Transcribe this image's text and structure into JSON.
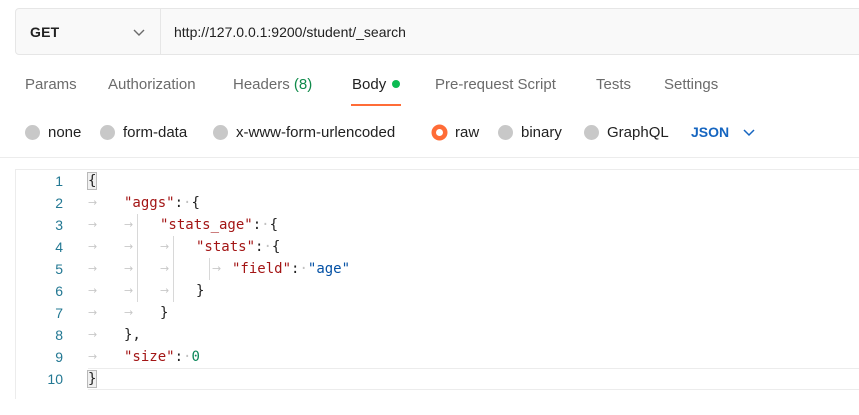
{
  "request": {
    "method": "GET",
    "url": "http://127.0.0.1:9200/student/_search"
  },
  "tabs": [
    {
      "label": "Params"
    },
    {
      "label": "Authorization"
    },
    {
      "label": "Headers",
      "count": "(8)"
    },
    {
      "label": "Body",
      "active": true,
      "indicator": "green-dot"
    },
    {
      "label": "Pre-request Script"
    },
    {
      "label": "Tests"
    },
    {
      "label": "Settings"
    }
  ],
  "body_types": {
    "options": [
      "none",
      "form-data",
      "x-www-form-urlencoded",
      "raw",
      "binary",
      "GraphQL"
    ],
    "selected": "raw",
    "format": "JSON"
  },
  "editor": {
    "line_numbers": [
      "1",
      "2",
      "3",
      "4",
      "5",
      "6",
      "7",
      "8",
      "9",
      "10"
    ],
    "tokens": {
      "open": "{",
      "close": "}",
      "close_comma": "},",
      "colon": ":",
      "aggs": "\"aggs\"",
      "stats_age": "\"stats_age\"",
      "stats": "\"stats\"",
      "field": "\"field\"",
      "age": "\"age\"",
      "size": "\"size\"",
      "zero": "0"
    }
  },
  "colors": {
    "accent": "#ff6c37",
    "active_dot": "#0cbb52",
    "json_link": "#1565c0",
    "key": "#a31515",
    "string": "#0451a5",
    "number": "#098658"
  }
}
